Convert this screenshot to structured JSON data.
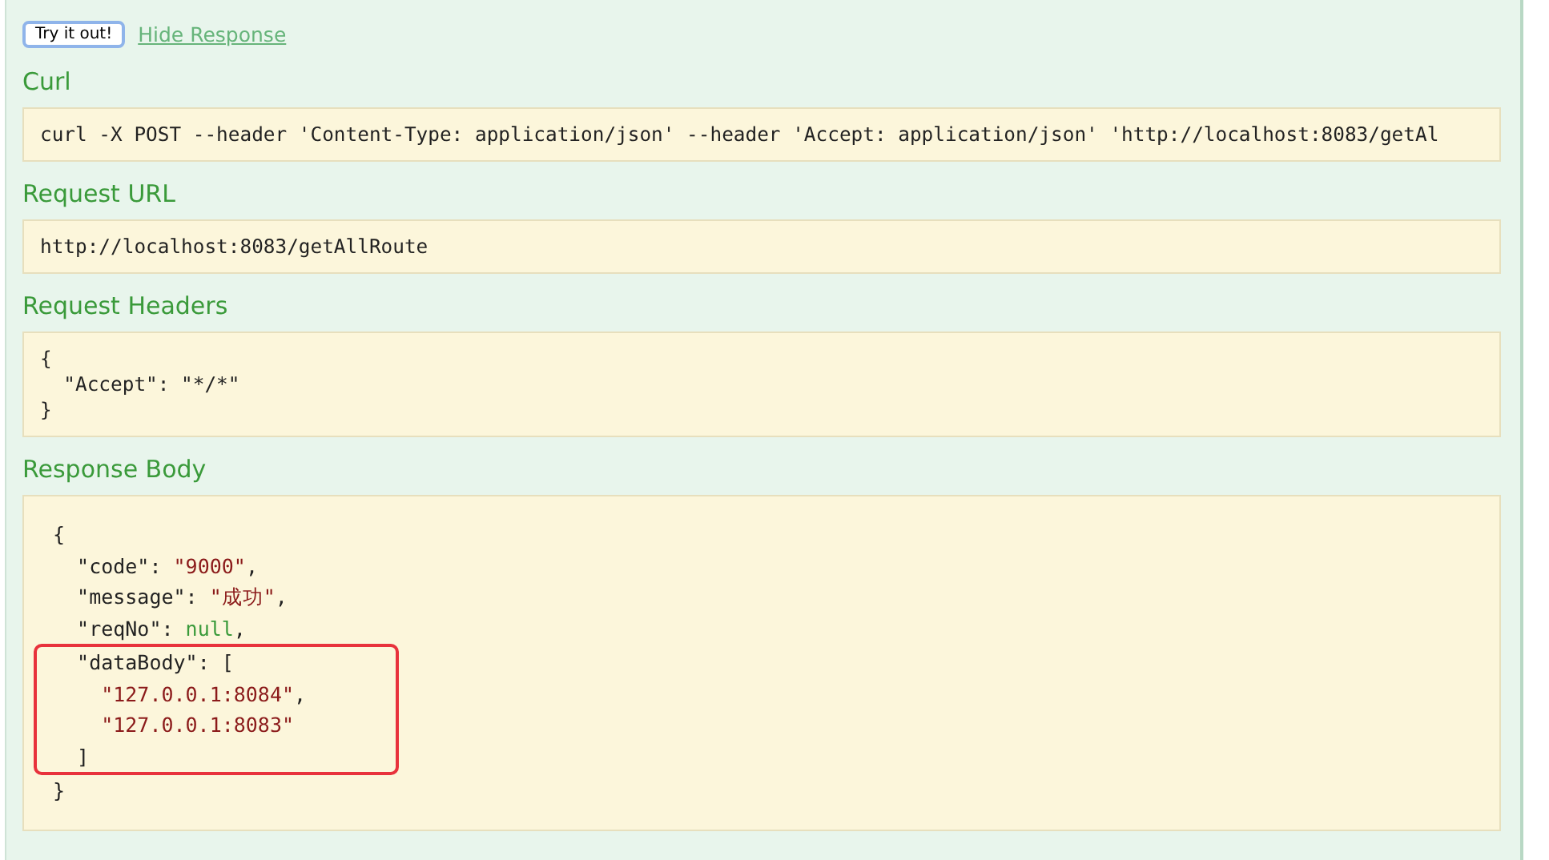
{
  "actions": {
    "try_button": "Try it out!",
    "hide_link": "Hide Response"
  },
  "sections": [
    {
      "title": "Curl",
      "kind": "text",
      "text": "curl -X POST --header 'Content-Type: application/json' --header 'Accept: application/json' 'http://localhost:8083/getAl"
    },
    {
      "title": "Request URL",
      "kind": "text",
      "text": "http://localhost:8083/getAllRoute"
    },
    {
      "title": "Request Headers",
      "kind": "text",
      "text": "{\n  \"Accept\": \"*/*\"\n}"
    },
    {
      "title": "Response Body",
      "kind": "code",
      "blocks": [
        {
          "highlighted": false,
          "lines": [
            [
              {
                "text": "{",
                "kind": "punct"
              }
            ],
            [
              {
                "text": "  \"code\"",
                "kind": "key"
              },
              {
                "text": ": ",
                "kind": "punct"
              },
              {
                "text": "\"9000\"",
                "kind": "string"
              },
              {
                "text": ",",
                "kind": "punct"
              }
            ],
            [
              {
                "text": "  \"message\"",
                "kind": "key"
              },
              {
                "text": ": ",
                "kind": "punct"
              },
              {
                "text": "\"成功\"",
                "kind": "string"
              },
              {
                "text": ",",
                "kind": "punct"
              }
            ],
            [
              {
                "text": "  \"reqNo\"",
                "kind": "key"
              },
              {
                "text": ": ",
                "kind": "punct"
              },
              {
                "text": "null",
                "kind": "null"
              },
              {
                "text": ",",
                "kind": "punct"
              }
            ]
          ]
        },
        {
          "highlighted": true,
          "lines": [
            [
              {
                "text": "  \"dataBody\"",
                "kind": "key"
              },
              {
                "text": ": [",
                "kind": "punct"
              }
            ],
            [
              {
                "text": "    \"127.0.0.1:8084\"",
                "kind": "string"
              },
              {
                "text": ",",
                "kind": "punct"
              }
            ],
            [
              {
                "text": "    \"127.0.0.1:8083\"",
                "kind": "string"
              }
            ],
            [
              {
                "text": "  ]",
                "kind": "punct"
              }
            ]
          ]
        },
        {
          "highlighted": false,
          "lines": [
            [
              {
                "text": "}",
                "kind": "punct"
              }
            ]
          ]
        }
      ]
    }
  ]
}
